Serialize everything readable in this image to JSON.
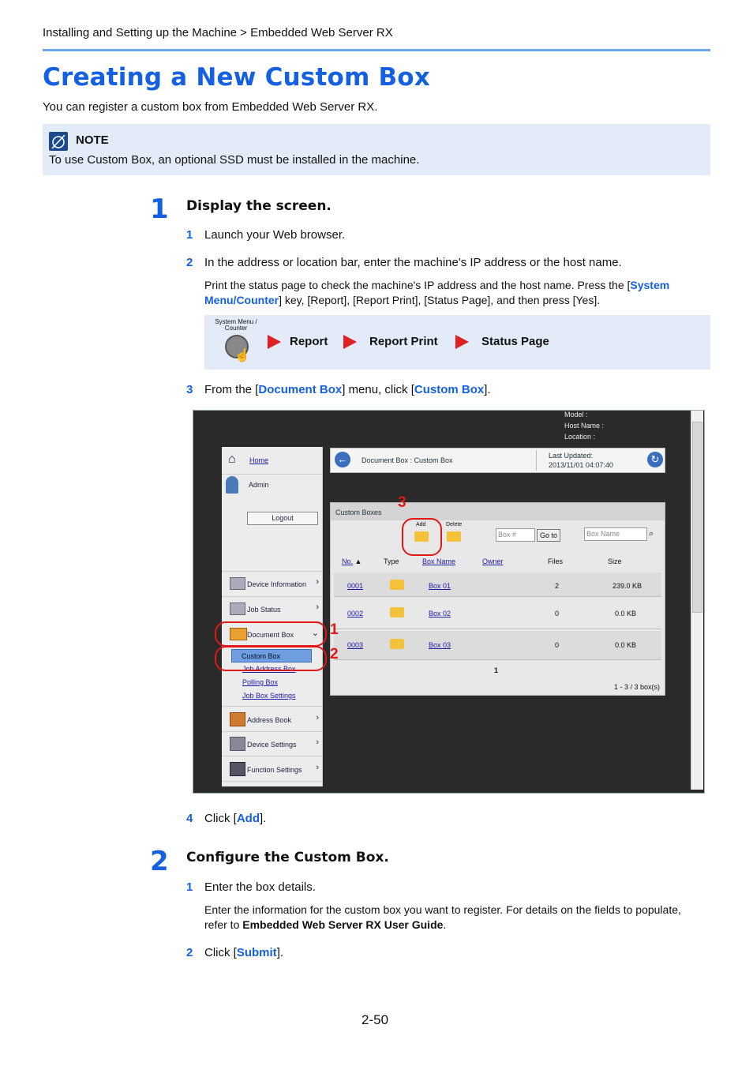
{
  "breadcrumb": "Installing and Setting up the Machine > Embedded Web Server RX",
  "title": "Creating a New Custom Box",
  "intro": "You can register a custom box from Embedded Web Server RX.",
  "note": {
    "label": "NOTE",
    "text": "To use Custom Box, an optional SSD must be installed in the machine."
  },
  "step1": {
    "num": "1",
    "title": "Display the screen.",
    "sub1": {
      "num": "1",
      "text": "Launch your Web browser."
    },
    "sub2": {
      "num": "2",
      "text": "In the address or location bar, enter the machine's IP address or the host name."
    },
    "detail_a": "Print the status page to check the machine's IP address and the host name. Press the [",
    "detail_b": "System Menu/Counter",
    "detail_c": "] key, [Report], [Report Print], [Status Page], and then press [Yes].",
    "panel": {
      "key_label": "System Menu / Counter",
      "flow": [
        "Report",
        "Report Print",
        "Status Page"
      ]
    },
    "sub3": {
      "num": "3",
      "pre": "From the [",
      "menu": "Document Box",
      "mid": "] menu, click [",
      "item": "Custom Box",
      "post": "]."
    },
    "sub4": {
      "num": "4",
      "pre": "Click [",
      "item": "Add",
      "post": "]."
    }
  },
  "screenshot": {
    "model_label": "Model :",
    "host_label": "Host Name :",
    "location_label": "Location :",
    "nav": {
      "home": "Home",
      "admin": "Admin",
      "logout": "Logout",
      "device_info": "Device Information",
      "job_status": "Job Status",
      "document_box": "Document Box",
      "custom_box": "Custom Box",
      "job_address_box": "Job Address Box",
      "polling_box": "Polling Box",
      "job_box_settings": "Job Box Settings",
      "address_book": "Address Book",
      "device_settings": "Device Settings",
      "function_settings": "Function Settings"
    },
    "header": {
      "path": "Document Box : Custom Box",
      "updated_label": "Last Updated:",
      "updated_value": "2013/11/01 04:07:40"
    },
    "panel_title": "Custom Boxes",
    "add": "Add",
    "delete": "Delete",
    "box_num_placeholder": "Box #",
    "goto": "Go to",
    "box_name_placeholder": "Box Name",
    "columns": [
      "No.",
      "Type",
      "Box Name",
      "Owner",
      "Files",
      "Size"
    ],
    "rows": [
      {
        "no": "0001",
        "name": "Box 01",
        "files": "2",
        "size": "239.0 KB"
      },
      {
        "no": "0002",
        "name": "Box 02",
        "files": "0",
        "size": "0.0 KB"
      },
      {
        "no": "0003",
        "name": "Box 03",
        "files": "0",
        "size": "0.0 KB"
      }
    ],
    "page": "1",
    "count": "1 - 3 / 3 box(s)",
    "callouts": [
      "1",
      "2",
      "3"
    ]
  },
  "step2": {
    "num": "2",
    "title": "Configure the Custom Box.",
    "sub1": {
      "num": "1",
      "text": "Enter the box details."
    },
    "detail_a": "Enter the information for the custom box you want to register. For details on the fields to populate, refer to ",
    "detail_b": "Embedded Web Server RX User Guide",
    "detail_c": ".",
    "sub2": {
      "num": "2",
      "pre": "Click [",
      "item": "Submit",
      "post": "]."
    }
  },
  "page_number": "2-50"
}
